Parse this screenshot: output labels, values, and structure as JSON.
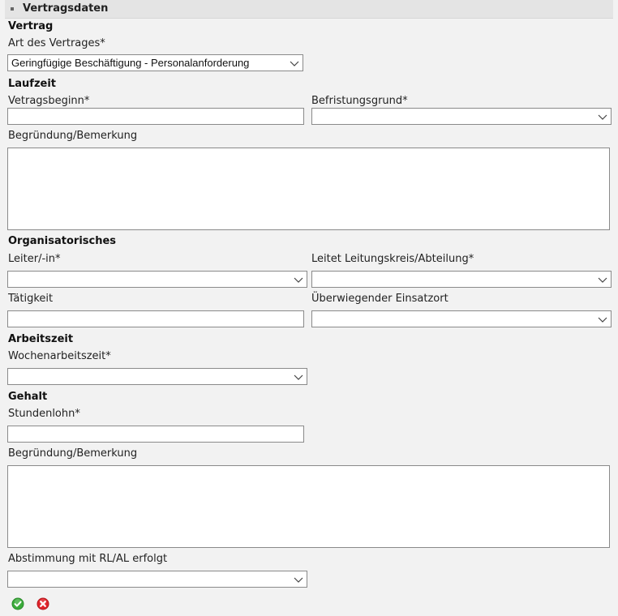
{
  "panel": {
    "title": "Vertragsdaten"
  },
  "sections": {
    "vertrag": "Vertrag",
    "laufzeit": "Laufzeit",
    "organisatorisches": "Organisatorisches",
    "arbeitszeit": "Arbeitszeit",
    "gehalt": "Gehalt"
  },
  "fields": {
    "art_des_vertrages": {
      "label": "Art des Vertrages*",
      "value": "Geringfügige Beschäftigung - Personalanforderung"
    },
    "vertragsbeginn": {
      "label": "Vetragsbeginn*",
      "value": ""
    },
    "befristungsgrund": {
      "label": "Befristungsgrund*",
      "value": ""
    },
    "begruendung1": {
      "label": "Begründung/Bemerkung",
      "value": ""
    },
    "leiter": {
      "label": "Leiter/-in*",
      "value": ""
    },
    "leitungskreis": {
      "label": "Leitet Leitungskreis/Abteilung*",
      "value": ""
    },
    "taetigkeit": {
      "label": "Tätigkeit",
      "value": ""
    },
    "einsatzort": {
      "label": "Überwiegender Einsatzort",
      "value": ""
    },
    "wochenarbeitszeit": {
      "label": "Wochenarbeitszeit*",
      "value": ""
    },
    "stundenlohn": {
      "label": "Stundenlohn*",
      "value": ""
    },
    "begruendung2": {
      "label": "Begründung/Bemerkung",
      "value": ""
    },
    "abstimmung": {
      "label": "Abstimmung mit RL/AL erfolgt",
      "value": ""
    }
  },
  "icons": {
    "confirm": "check-circle-icon",
    "cancel": "cancel-circle-icon",
    "confirm_color": "#3bab3b",
    "cancel_color": "#e0242b"
  }
}
